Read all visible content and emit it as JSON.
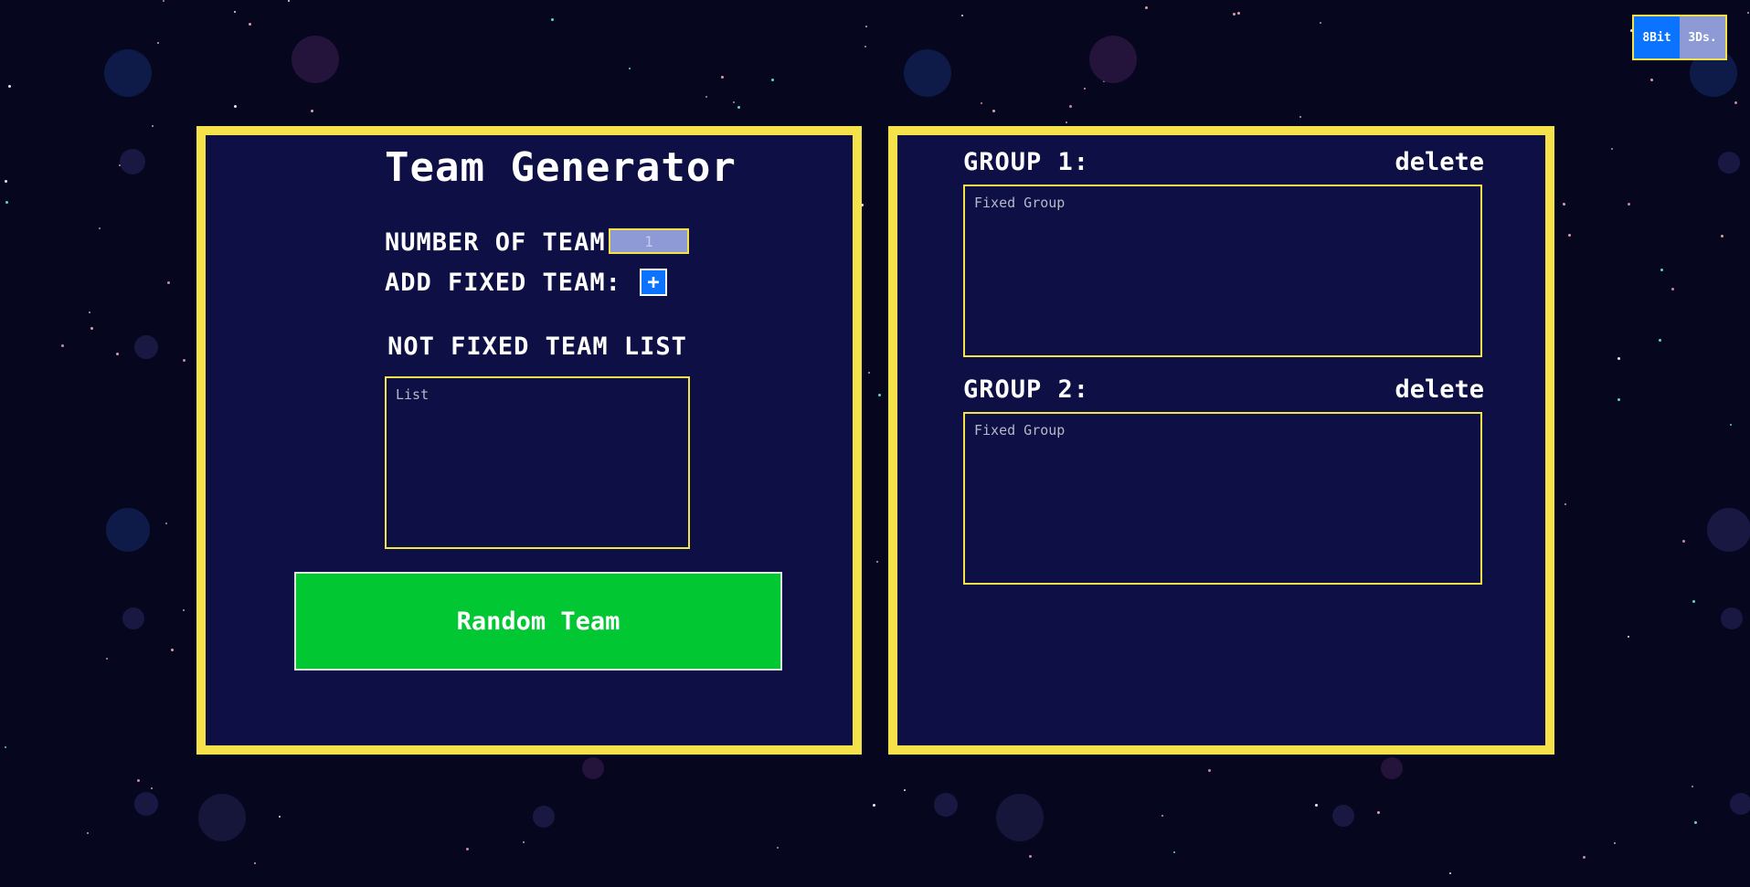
{
  "theme_toggle": {
    "option_8bit": "8Bit",
    "option_3ds": "3Ds."
  },
  "generator": {
    "title": "Team Generator",
    "number_of_team_label": "NUMBER OF TEAM:",
    "number_of_team_value": "1",
    "add_fixed_team_label": "ADD FIXED TEAM:",
    "add_button_symbol": "+",
    "not_fixed_list_heading": "NOT FIXED TEAM LIST",
    "list_placeholder": "List",
    "random_button": "Random Team"
  },
  "groups": [
    {
      "label": "GROUP 1:",
      "delete_label": "delete",
      "placeholder": "Fixed Group"
    },
    {
      "label": "GROUP 2:",
      "delete_label": "delete",
      "placeholder": "Fixed Group"
    }
  ],
  "colors": {
    "background": "#06061f",
    "panel": "#0d0f45",
    "border": "#f5e24a",
    "accent_blue": "#0a73ff",
    "button_green": "#00c732"
  }
}
